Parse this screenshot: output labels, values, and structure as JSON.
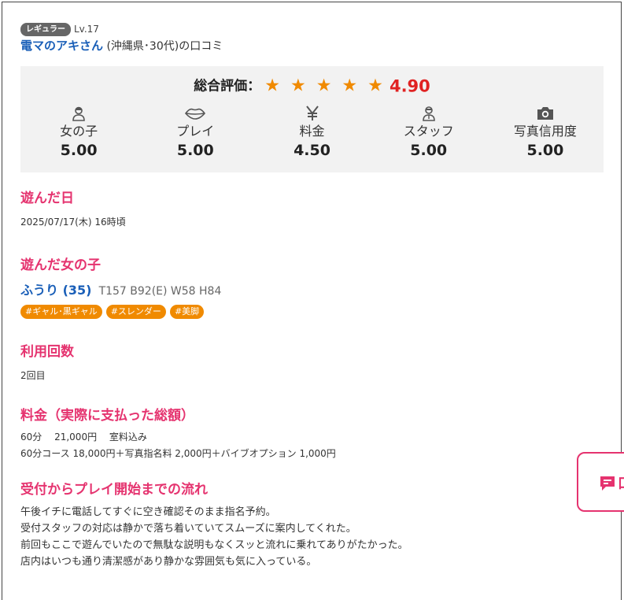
{
  "reviewer": {
    "rank_badge": "レギュラー",
    "level": "Lv.17",
    "name": "電マのアキさん",
    "meta": "(沖縄県･30代)の口コミ"
  },
  "overall": {
    "label": "総合評価：",
    "stars": "★ ★ ★ ★ ★",
    "rating": 5,
    "value": "4.90",
    "star_color": "#f08a00",
    "value_color": "#e02222"
  },
  "categories": [
    {
      "icon": "person-icon",
      "label": "女の子",
      "value": "5.00"
    },
    {
      "icon": "lips-icon",
      "label": "プレイ",
      "value": "5.00"
    },
    {
      "icon": "yen-icon",
      "label": "料金",
      "value": "4.50"
    },
    {
      "icon": "staff-icon",
      "label": "スタッフ",
      "value": "5.00"
    },
    {
      "icon": "camera-icon",
      "label": "写真信用度",
      "value": "5.00"
    }
  ],
  "visit_date": {
    "title": "遊んだ日",
    "value": "2025/07/17(木) 16時頃"
  },
  "girl": {
    "title": "遊んだ女の子",
    "name": "ふうり (35)",
    "size": "T157 B92(E) W58 H84",
    "tags": [
      "#ギャル･黒ギャル",
      "#スレンダー",
      "#美脚"
    ]
  },
  "usage": {
    "title": "利用回数",
    "value": "2回目"
  },
  "price": {
    "title": "料金（実際に支払った総額）",
    "line1": "60分　 21,000円　 室料込み",
    "line2": "60分コース 18,000円＋写真指名料 2,000円＋バイブオプション 1,000円"
  },
  "flow": {
    "title": "受付からプレイ開始までの流れ",
    "lines": [
      "午後イチに電話してすぐに空き確認そのまま指名予約。",
      "受付スタッフの対応は静かで落ち着いていてスムーズに案内してくれた。",
      "前回もここで遊んでいたので無駄な説明もなくスッと流れに乗れてありがたかった。",
      "店内はいつも通り清潔感があり静かな雰囲気も気に入っている。"
    ]
  },
  "float_button": {
    "label": "口",
    "icon": "comment-icon",
    "color": "#e5336f"
  },
  "accent": {
    "pink": "#e5336f",
    "blue": "#1a5fb8",
    "orange": "#f08a00"
  }
}
